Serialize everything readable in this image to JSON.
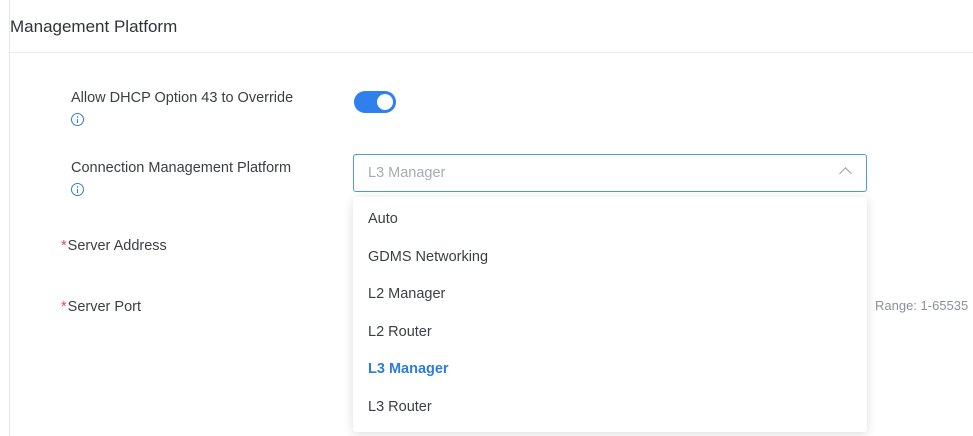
{
  "section": {
    "title": "Management Platform"
  },
  "dhcp": {
    "label": "Allow DHCP Option 43 to Override",
    "enabled": true
  },
  "connection": {
    "label": "Connection Management Platform",
    "selected_value": "L3 Manager",
    "options": [
      "Auto",
      "GDMS Networking",
      "L2 Manager",
      "L2 Router",
      "L3 Manager",
      "L3 Router"
    ],
    "selected_index": 4
  },
  "server_address": {
    "required_mark": "*",
    "label": "Server Address"
  },
  "server_port": {
    "required_mark": "*",
    "label": "Server Port",
    "hint": "Range: 1-65535"
  },
  "colors": {
    "accent": "#2f80ed",
    "required": "#e5484d",
    "selected_option": "#2e7ed7"
  }
}
